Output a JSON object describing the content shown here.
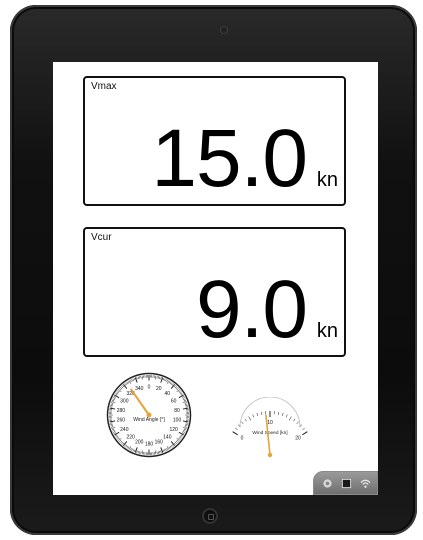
{
  "max_panel": {
    "label": "Vmax",
    "value": "15.0",
    "unit": "kn"
  },
  "cur_panel": {
    "label": "Vcur",
    "value": "9.0",
    "unit": "kn"
  },
  "wind_angle_gauge": {
    "title": "Wind Angle [°]",
    "ticks": [
      "0",
      "20",
      "40",
      "60",
      "80",
      "100",
      "120",
      "140",
      "160",
      "180",
      "200",
      "220",
      "240",
      "260",
      "280",
      "300",
      "320",
      "340"
    ],
    "needle_value_deg": 325
  },
  "wind_speed_gauge": {
    "title": "Wind Speed [kn]",
    "ticks": [
      "0",
      "10",
      "20"
    ],
    "needle_value": 9
  },
  "status_icons": [
    "settings-icon",
    "stop-icon",
    "wifi-icon"
  ],
  "colors": {
    "needle": "#e5a33a",
    "bezel": "#0c0c0c",
    "screen": "#ffffff"
  }
}
